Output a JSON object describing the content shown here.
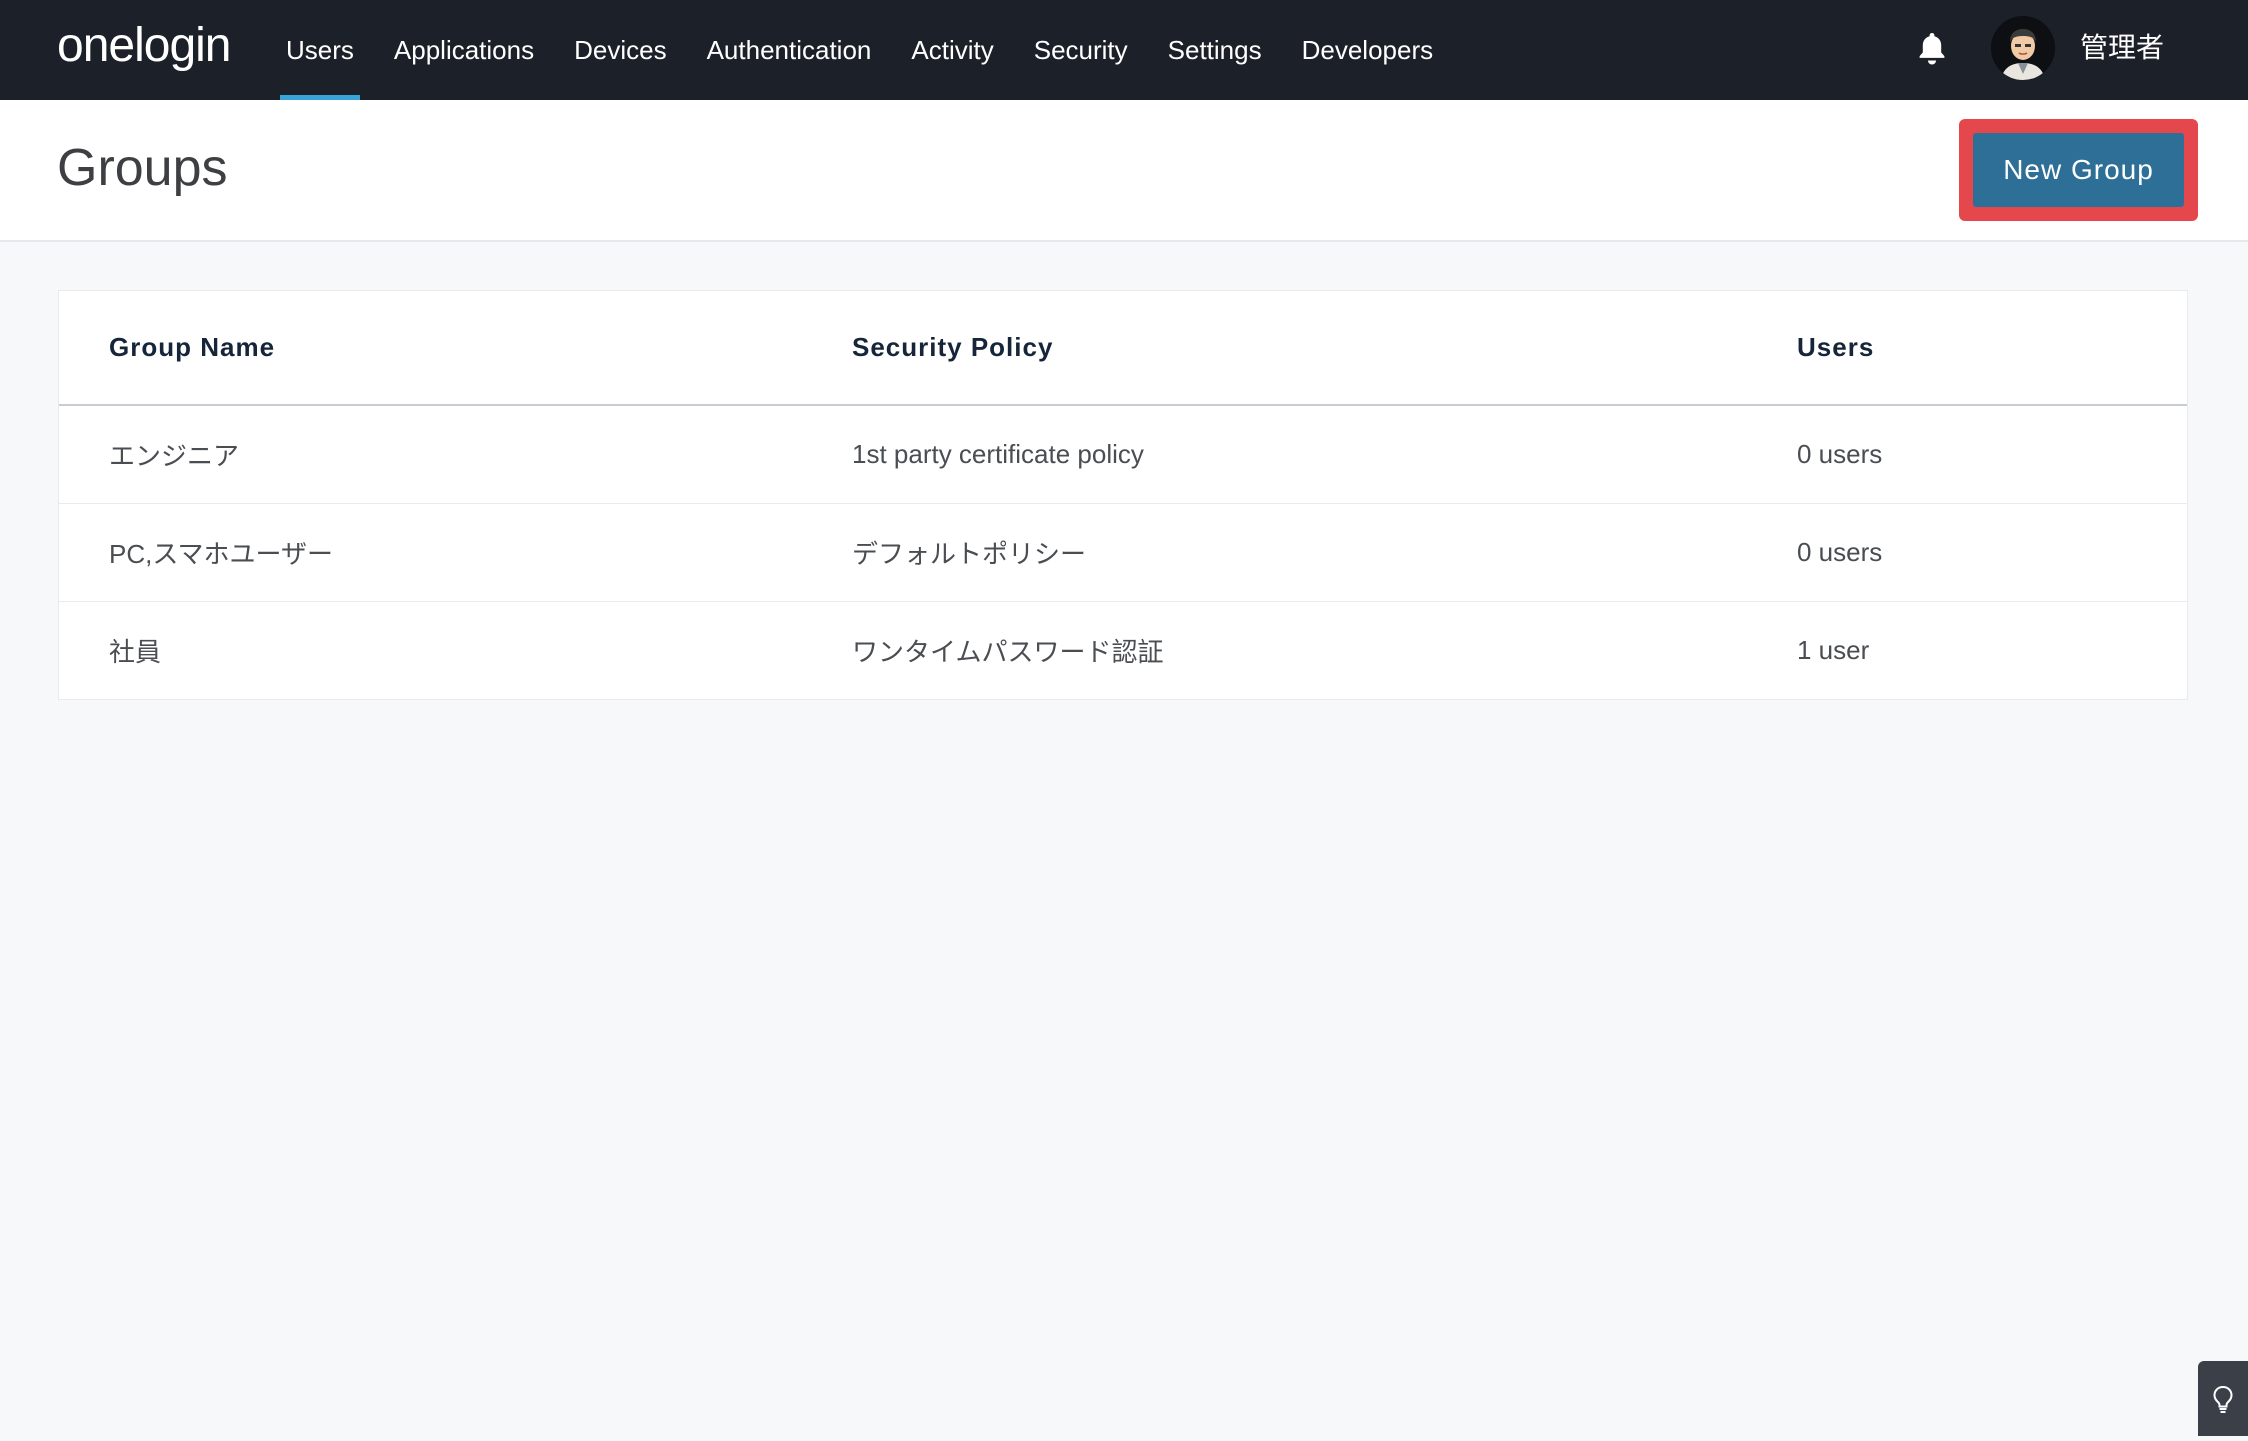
{
  "app": {
    "logo": "onelogin"
  },
  "nav": {
    "items": [
      {
        "label": "Users",
        "active": true
      },
      {
        "label": "Applications"
      },
      {
        "label": "Devices"
      },
      {
        "label": "Authentication"
      },
      {
        "label": "Activity"
      },
      {
        "label": "Security"
      },
      {
        "label": "Settings"
      },
      {
        "label": "Developers"
      }
    ]
  },
  "user": {
    "name": "管理者"
  },
  "page": {
    "title": "Groups",
    "new_group_label": "New Group"
  },
  "table": {
    "headers": [
      "Group Name",
      "Security Policy",
      "Users"
    ],
    "rows": [
      [
        "エンジニア",
        "1st party certificate policy",
        "0 users"
      ],
      [
        "PC,スマホユーザー",
        "デフォルトポリシー",
        "0 users"
      ],
      [
        "社員",
        "ワンタイムパスワード認証",
        "1 user"
      ]
    ]
  },
  "colors": {
    "topbar": "#1c2029",
    "accent": "#3aa3d9",
    "button": "#2d6f96",
    "highlight": "#e4484d"
  },
  "icons": {
    "notifications": "bell-icon",
    "help": "lightbulb-icon"
  }
}
